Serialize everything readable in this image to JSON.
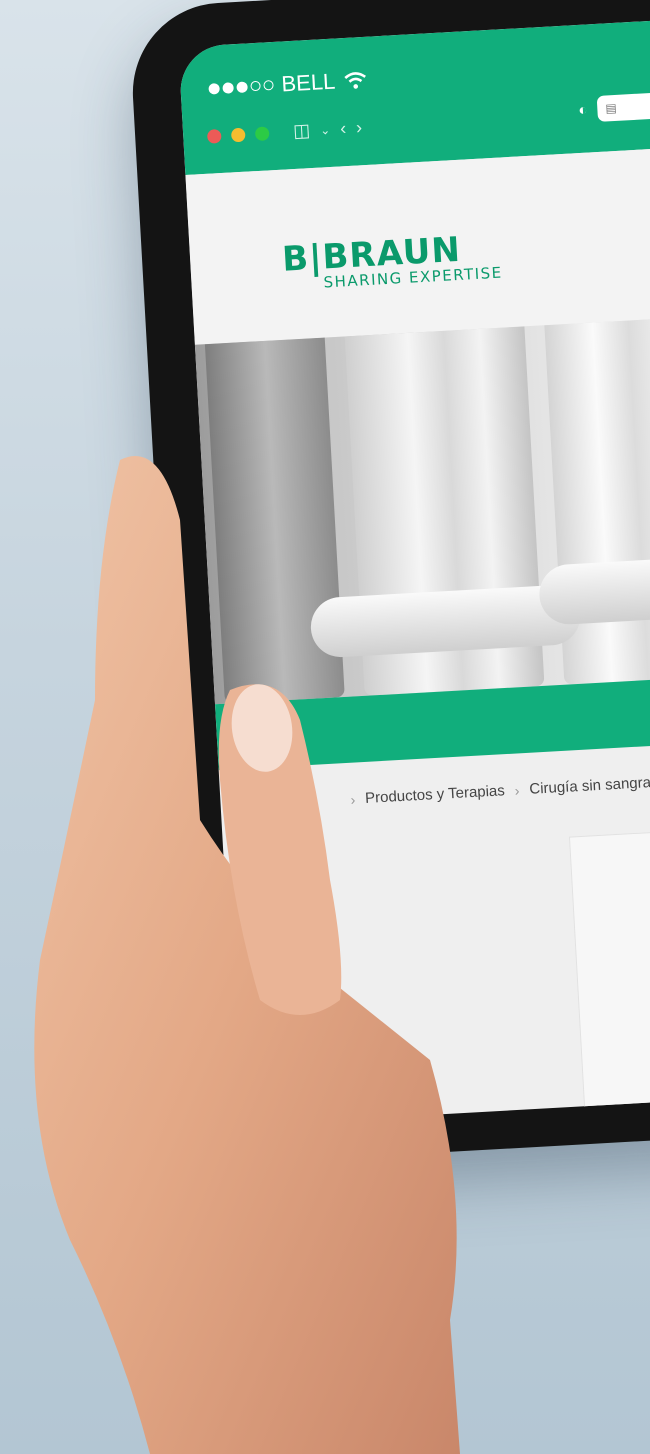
{
  "status_bar": {
    "carrier": "BELL",
    "wifi_icon": "wifi-icon",
    "signal_icon": "signal-dots-icon"
  },
  "toolbar": {
    "window_controls": [
      "#ec5b57",
      "#f4bd2f",
      "#2ccb45"
    ],
    "sidebar_icon": "sidebar-icon",
    "back_icon": "chevron-left-icon",
    "forward_icon": "chevron-right-icon",
    "privacy_icon": "shield-half-icon",
    "reader_icon": "page-icon"
  },
  "brand": {
    "name": "B|BRAUN",
    "tagline": "SHARING EXPERTISE",
    "color": "#0a9a6b"
  },
  "theme": {
    "accent": "#11ae7c"
  },
  "breadcrumb": {
    "items": [
      "Productos y Terapias",
      "Cirugía sin sangra"
    ]
  }
}
